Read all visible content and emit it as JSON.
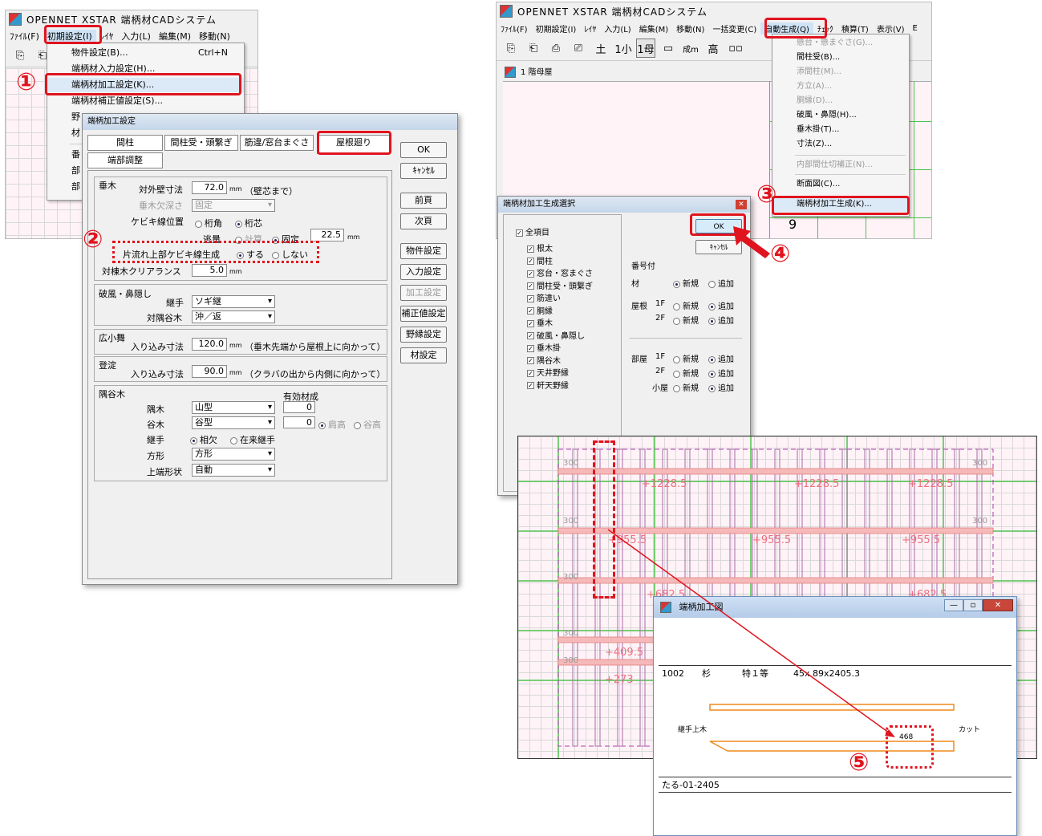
{
  "app_title": "OPENNET XSTAR 端柄材CADシステム",
  "left_menu": [
    "ﾌｧｲﾙ(F)",
    "初期設定(I)",
    "ﾚｲﾔ",
    "入力(L)",
    "編集(M)",
    "移動(N)"
  ],
  "init_menu_items": [
    {
      "label": "物件設定(B)...",
      "shortcut": "Ctrl+N"
    },
    {
      "label": "端柄材入力設定(H)...",
      "shortcut": ""
    },
    {
      "label": "端柄材加工設定(K)...",
      "shortcut": ""
    },
    {
      "label": "端柄材補正値設定(S)...",
      "shortcut": ""
    },
    {
      "label": "野",
      "shortcut": ""
    },
    {
      "label": "材",
      "shortcut": ""
    },
    {
      "label": "番",
      "shortcut": ""
    },
    {
      "label": "部",
      "shortcut": ""
    },
    {
      "label": "部",
      "shortcut": ""
    }
  ],
  "proc_dialog": {
    "title": "端柄加工設定",
    "tabs": [
      "間柱",
      "間柱受・頭繋ぎ",
      "筋違/窓台まぐさ",
      "屋根廻り",
      "端部調整"
    ],
    "buttons": [
      "OK",
      "ｷｬﾝｾﾙ",
      "前頁",
      "次頁",
      "物件設定",
      "入力設定",
      "加工設定",
      "補正値設定",
      "野縁設定",
      "材設定"
    ],
    "taruki": {
      "heading": "垂木",
      "wall_label": "対外壁寸法",
      "wall_value": "72.0",
      "unit": "mm",
      "wall_note": "（壁芯まで）",
      "depth_label": "垂木欠深さ",
      "depth_value": "固定",
      "kebiki_label": "ケビキ線位置",
      "kebiki_opt1": "桁角",
      "kebiki_opt2": "桁芯",
      "flow_label": "逃量",
      "flow_opt1": "計算",
      "flow_opt2": "固定",
      "flow_value": "22.5",
      "kata_label": "片流れ上部ケビキ線生成",
      "kata_opt1": "する",
      "kata_opt2": "しない",
      "clear_label": "対棟木クリアランス",
      "clear_value": "5.0"
    },
    "hafu": {
      "heading": "破風・鼻隠し",
      "tsugite_label": "継手",
      "tsugite_value": "ソギ継",
      "sumi_label": "対隅谷木",
      "sumi_value": "沖／返"
    },
    "komai": {
      "heading": "広小舞",
      "label": "入り込み寸法",
      "value": "120.0",
      "note": "（垂木先端から屋根上に向かって）"
    },
    "yodo": {
      "heading": "登淀",
      "label": "入り込み寸法",
      "value": "90.0",
      "note": "（クラバの出から内側に向かって）"
    },
    "sumiyagi": {
      "heading": "隅谷木",
      "eff_label": "有効材成",
      "sumi_label": "隅木",
      "sumi_value": "山型",
      "sumi_eff": "0",
      "tani_label": "谷木",
      "tani_value": "谷型",
      "tani_eff": "0",
      "opt_a": "肩高",
      "opt_b": "谷高",
      "tsugi_label": "継手",
      "tsugi_opt1": "相欠",
      "tsugi_opt2": "在来継手",
      "hogata_label": "方形",
      "hogata_value": "方形",
      "top_label": "上端形状",
      "top_value": "自動"
    }
  },
  "right_menu": [
    "ﾌｧｲﾙ(F)",
    "初期設定(I)",
    "ﾚｲﾔ",
    "入力(L)",
    "編集(M)",
    "移動(N)",
    "一括変更(C)",
    "自動生成(Q)",
    "ﾁｪｯｸ",
    "積算(T)",
    "表示(V)",
    "E"
  ],
  "toolbar_glyphs": [
    "土",
    "1小",
    "1母",
    "▭",
    "成m",
    "高",
    "▫▫"
  ],
  "doc_tab": "1 階母屋",
  "auto_menu_items": [
    "懸台・懸まぐさ(G)...",
    "間柱受(B)...",
    "添間柱(M)...",
    "方立(A)...",
    "胴縁(D)...",
    "破風・鼻隠(H)...",
    "垂木掛(T)...",
    "寸法(Z)...",
    "内部間仕切補正(N)...",
    "断面図(C)...",
    "端柄材加工生成(K)..."
  ],
  "gen_dialog": {
    "title": "端柄材加工生成選択",
    "all_label": "全項目",
    "items": [
      "根太",
      "間柱",
      "窓台・窓まぐさ",
      "間柱受・頭繋ぎ",
      "筋違い",
      "胴縁",
      "垂木",
      "破風・鼻隠し",
      "垂木掛",
      "隅谷木",
      "天井野縁",
      "軒天野縁"
    ],
    "ok": "OK",
    "cancel": "ｷｬﾝｾﾙ",
    "numbering": "番号付",
    "zai_label": "材",
    "new": "新規",
    "add": "追加",
    "roof_label": "屋根",
    "room_label": "部屋",
    "f1": "1F",
    "f2": "2F",
    "small_room": "小屋"
  },
  "plan": {
    "label300": "300",
    "top_dims": [
      "+1228.5",
      "+1228.5",
      "+1228.5"
    ],
    "mid_dims": [
      "+955.5",
      "+955.5",
      "+955.5"
    ],
    "low_dims": [
      "+682.5",
      "+682.5",
      "+409.5",
      "+273"
    ]
  },
  "parts_window": {
    "title": "端柄加工図",
    "spec_no": "1002",
    "spec_wood": "杉",
    "spec_grade": "特１等",
    "spec_size": "45x 89x2405.3",
    "left_note": "継手上木",
    "right_note": "カット",
    "dim": "468",
    "footer": "たる-01-2405"
  },
  "steps": [
    "①",
    "②",
    "③",
    "④",
    "⑤"
  ],
  "colors": {
    "accent_red": "#e0141e",
    "orange": "#f08a1c",
    "grid_green": "#4dc24d",
    "rafter_pink": "#c0349a"
  }
}
